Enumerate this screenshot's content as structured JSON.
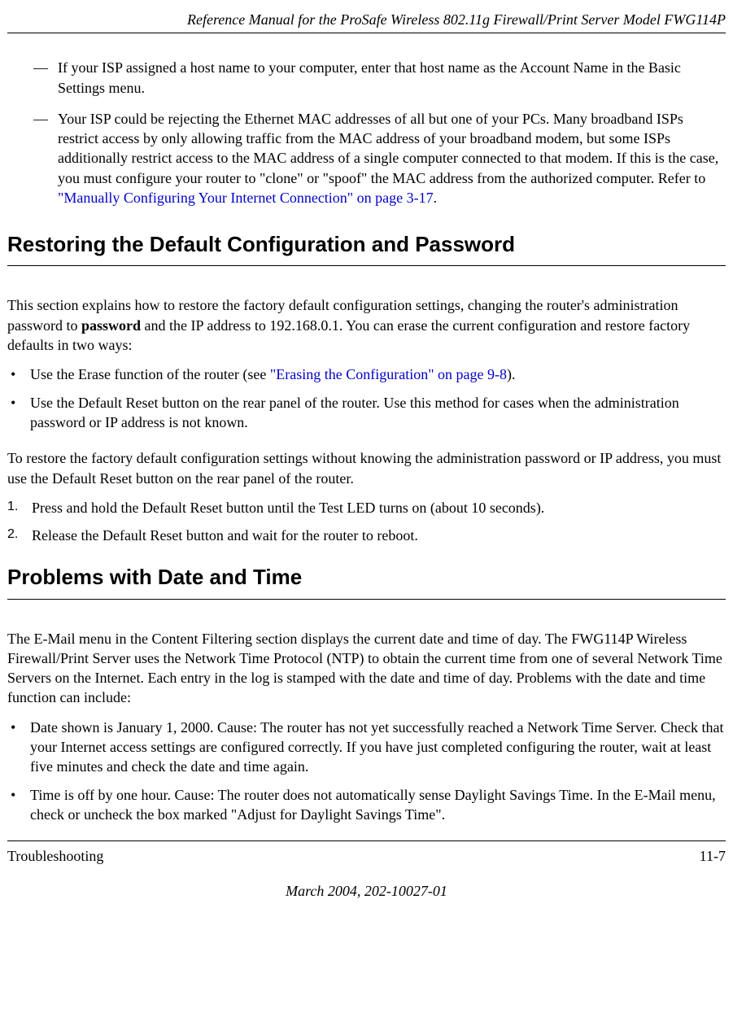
{
  "header": {
    "title": "Reference Manual for the ProSafe Wireless 802.11g  Firewall/Print Server Model FWG114P"
  },
  "dashItems": [
    {
      "text": "If your ISP assigned a host name to your computer, enter that host name as the Account Name in the Basic Settings menu."
    },
    {
      "preLink": "Your ISP could be rejecting the Ethernet MAC addresses of all but one of your PCs. Many broadband ISPs restrict access by only allowing traffic from the MAC address of your broadband modem, but some ISPs additionally restrict access to the MAC address of a single computer connected to that modem. If this is the case, you must configure your router to \"clone\" or \"spoof\" the MAC address from the authorized computer. Refer to ",
      "link": "\"Manually Configuring Your Internet Connection\" on page 3-17",
      "postLink": "."
    }
  ],
  "section1": {
    "heading": "Restoring the Default Configuration and Password",
    "intro_pre": "This section explains how to restore the factory default configuration settings, changing the router's administration password to ",
    "intro_bold": "password",
    "intro_post": " and the IP address to 192.168.0.1. You can erase the current configuration and restore factory defaults in two ways:",
    "bullets": [
      {
        "pre": "Use the Erase function of the router (see ",
        "link": "\"Erasing the Configuration\" on page 9-8",
        "post": ")."
      },
      {
        "text": "Use the Default Reset button on the rear panel of the router. Use this method for cases when the administration password or IP address is not known."
      }
    ],
    "para2": "To restore the factory default configuration settings without knowing the administration password or IP address, you must use the Default Reset button on the rear panel of the router.",
    "steps": [
      "Press and hold the Default Reset button until the Test LED turns on (about 10 seconds).",
      "Release the Default Reset button and wait for the router to reboot."
    ]
  },
  "section2": {
    "heading": "Problems with Date and Time",
    "intro": "The E-Mail menu in the Content Filtering section displays the current date and time of day. The FWG114P Wireless Firewall/Print Server uses the Network Time Protocol (NTP) to obtain the current time from one of several Network Time Servers on the Internet. Each entry in the log is stamped with the date and time of day. Problems with the date and time function can include:",
    "bullets": [
      "Date shown is January 1, 2000. Cause: The router has not yet successfully reached a Network Time Server. Check that your Internet access settings are configured correctly. If you have just completed configuring the router, wait at least five minutes and check the date and time again.",
      "Time is off by one hour. Cause: The router does not automatically sense Daylight Savings Time. In the E-Mail menu, check or uncheck the box marked \"Adjust for Daylight Savings Time\"."
    ]
  },
  "footer": {
    "left": "Troubleshooting",
    "right": "11-7",
    "date": "March 2004, 202-10027-01"
  }
}
